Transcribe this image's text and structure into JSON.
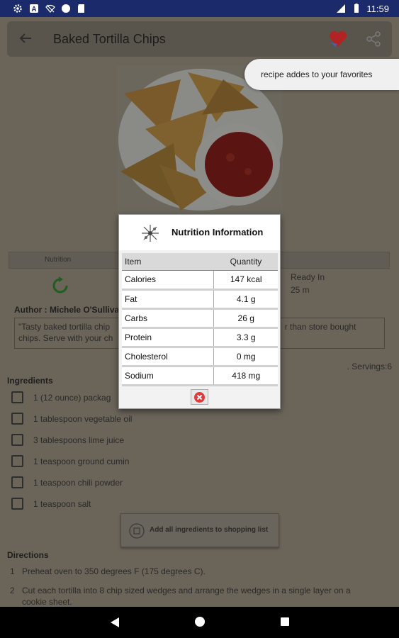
{
  "status_bar": {
    "time": "11:59"
  },
  "toolbar": {
    "title": "Baked Tortilla Chips"
  },
  "toast": {
    "message": "recipe addes to your favorites"
  },
  "recipe": {
    "tab_left_label": "Nutrition",
    "ready_label": "Ready In",
    "ready_value": "25 m",
    "author": "Author : Michele O'Sullivan",
    "description": "\"Tasty baked tortilla chips ... healthier than store bought chips. Serve with your choice...\"",
    "description_visible_start": "\"Tasty baked tortilla chip",
    "description_visible_end": "r than store bought",
    "description_line2": "chips. Serve with your ch",
    "servings": ". Servings:6"
  },
  "ingredients": {
    "title": "Ingredients",
    "items": [
      "1 (12 ounce) packag",
      "1 tablespoon vegetable oil",
      "3 tablespoons lime juice",
      "1 teaspoon ground cumin",
      "1 teaspoon chili powder",
      "1 teaspoon salt"
    ]
  },
  "shopping": {
    "button_label": "Add all ingredients to shopping list"
  },
  "directions": {
    "title": "Directions",
    "steps": [
      {
        "num": "1",
        "text": "Preheat oven to 350 degrees F (175 degrees C)."
      },
      {
        "num": "2",
        "text": "Cut each tortilla into 8 chip sized wedges and arrange the wedges in a single layer on a"
      },
      {
        "num": "",
        "text": "cookie sheet."
      }
    ]
  },
  "nutrition_modal": {
    "title": "Nutrition Information",
    "col_item": "Item",
    "col_qty": "Quantity",
    "rows": [
      {
        "item": "Calories",
        "qty": "147 kcal"
      },
      {
        "item": "Fat",
        "qty": "4.1 g"
      },
      {
        "item": "Carbs",
        "qty": "26 g"
      },
      {
        "item": "Protein",
        "qty": "3.3 g"
      },
      {
        "item": "Cholesterol",
        "qty": "0 mg"
      },
      {
        "item": "Sodium",
        "qty": "418 mg"
      }
    ]
  },
  "colors": {
    "status_bar": "#1b2a6b",
    "favorite_heart": "#e0202a",
    "close_button": "#e63838"
  }
}
